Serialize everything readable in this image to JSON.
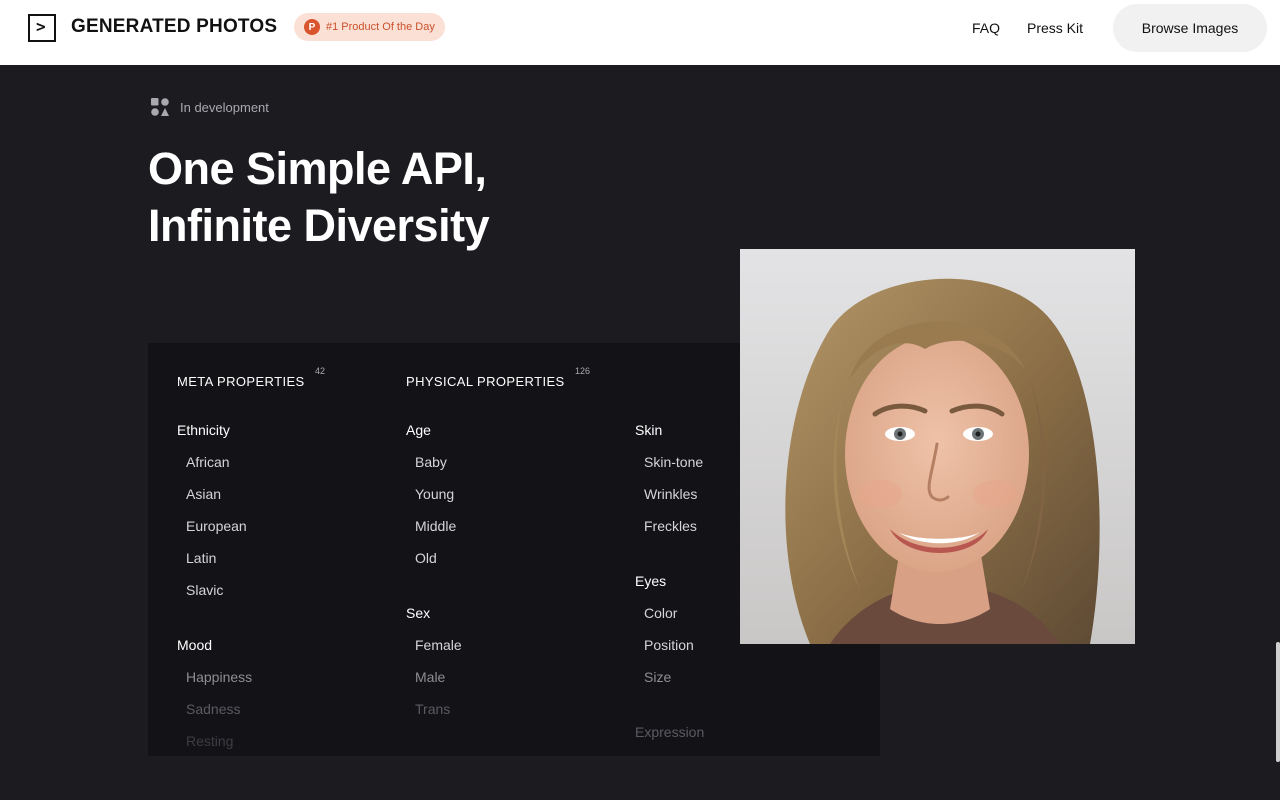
{
  "header": {
    "logo_glyph": ">",
    "brand": "GENERATED PHOTOS",
    "badge_letter": "P",
    "badge_text": "#1 Product Of the Day",
    "nav": {
      "faq": "FAQ",
      "press_kit": "Press Kit"
    },
    "browse_button": "Browse Images"
  },
  "hero": {
    "status": "In development",
    "title_line1": "One Simple API,",
    "title_line2": "Infinite Diversity"
  },
  "meta": {
    "title": "META PROPERTIES",
    "count": "42",
    "ethnicity": {
      "label": "Ethnicity",
      "items": [
        "African",
        "Asian",
        "European",
        "Latin",
        "Slavic"
      ]
    },
    "mood": {
      "label": "Mood",
      "items": [
        "Happiness",
        "Sadness",
        "Resting"
      ]
    }
  },
  "physical": {
    "title": "PHYSICAL PROPERTIES",
    "count": "126",
    "age": {
      "label": "Age",
      "items": [
        "Baby",
        "Young",
        "Middle",
        "Old"
      ]
    },
    "sex": {
      "label": "Sex",
      "items": [
        "Female",
        "Male",
        "Trans"
      ]
    },
    "skin": {
      "label": "Skin",
      "items": [
        "Skin-tone",
        "Wrinkles",
        "Freckles"
      ]
    },
    "eyes": {
      "label": "Eyes",
      "items": [
        "Color",
        "Position",
        "Size"
      ]
    },
    "expression": {
      "label": "Expression"
    }
  },
  "icons": {
    "logo": "terminal-prompt-icon",
    "badge": "product-hunt-icon",
    "status": "shapes-icon"
  },
  "colors": {
    "background": "#1b1b20",
    "panel": "#131317",
    "header": "#ffffff",
    "badge_bg": "#fbe0d6",
    "badge_accent": "#d9552e"
  }
}
